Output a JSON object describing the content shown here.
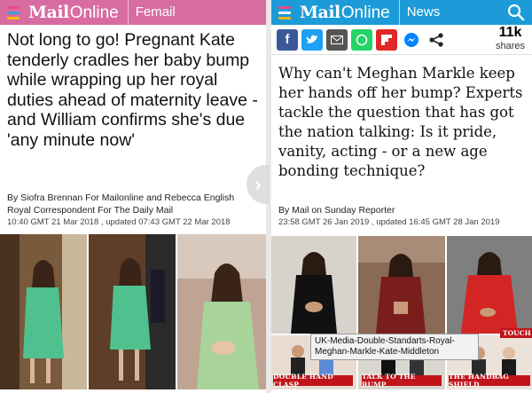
{
  "left": {
    "logo_mail": "Mail",
    "logo_online": "Online",
    "section": "Femail",
    "headline": "Not long to go! Pregnant Kate tenderly cradles her baby bump while wrapping up her royal duties ahead of maternity leave - and William confirms she's due 'any minute now'",
    "byline_1": "By Siofra Brennan For Mailonline and Rebecca English",
    "byline_2": "Royal Correspondent For The Daily Mail",
    "dateline": "10:40 GMT 21 Mar 2018 , updated 07:43 GMT 22 Mar 2018"
  },
  "right": {
    "logo_mail": "Mail",
    "logo_online": "Online",
    "section": "News",
    "share_count": "11k",
    "share_label": "shares",
    "headline": "Why can't Meghan Markle keep her hands off her bump? Experts tackle the question that has got the nation talking: Is it pride, vanity, acting - or a new age bonding technique?",
    "byline": "By Mail on Sunday Reporter",
    "dateline": "23:58 GMT 26 Jan 2019 , updated 16:45 GMT 28 Jan 2019",
    "captions": [
      "DOUBLE HAND CLASP",
      "TALK TO THE BUMP",
      "THE HANDBAG SHIELD"
    ],
    "touch_label": "TOUCH",
    "tooltip": "UK-Media-Double-Standarts-Royal-Meghan-Markle-Kate-Middleton"
  },
  "colors": {
    "femail_bar": "#d86ca0",
    "news_bar": "#1d9bd9",
    "facebook": "#3b5998",
    "twitter": "#1da1f2",
    "email": "#555555",
    "whatsapp": "#25d366",
    "flipboard": "#e12828",
    "messenger": "#0084ff",
    "caption_red": "#c0141b"
  }
}
